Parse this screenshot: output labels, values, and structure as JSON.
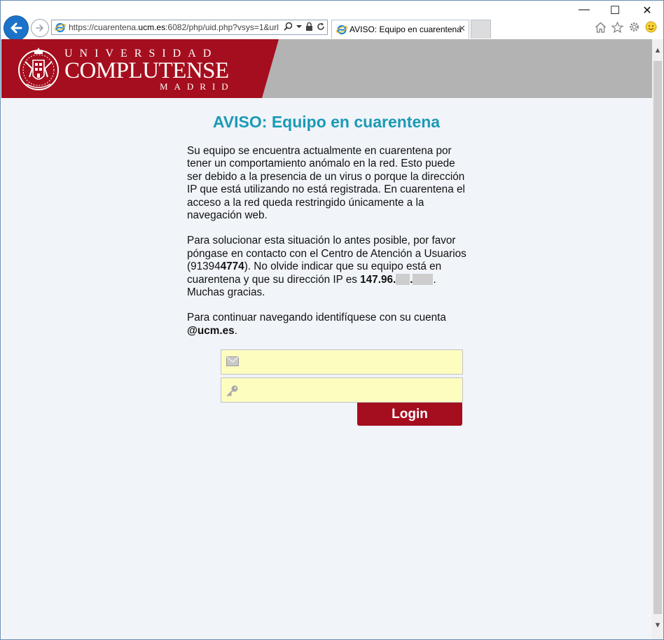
{
  "browser": {
    "url_prefix": "https://cuarentena.",
    "url_host": "ucm.es",
    "url_suffix": ":6082/php/uid.php?vsys=1&url",
    "tab_title": "AVISO: Equipo en cuarentena",
    "tab_close": "✕",
    "minimize": "—",
    "maximize": "☐",
    "close": "✕"
  },
  "logo": {
    "line1": "UNIVERSIDAD",
    "line2": "COMPLUTENSE",
    "line3": "MADRID"
  },
  "page": {
    "title": "AVISO: Equipo en cuarentena",
    "para1": "Su equipo se encuentra actualmente en cuarentena por tener un comportamiento anómalo en la red. Esto puede ser debido a la presencia de un virus o porque la dirección IP que está utilizando no está registrada. En cuarentena el acceso a la red queda restringido únicamente a la navegación web.",
    "para2_a": "Para solucionar esta situación lo antes posible, por favor póngase en contacto con el Centro de Atención a Usuarios (",
    "phone_a": "91394",
    "phone_b": "4774",
    "para2_b": "). No olvide indicar que su equipo está en cuarentena y que su dirección IP es ",
    "ip_prefix": "147.96.",
    "ip_dot": ".",
    "para2_c": ". Muchas gracias.",
    "para3_a": "Para continuar navegando identifíquese con su cuenta ",
    "para3_domain": "@ucm.es",
    "para3_end": "."
  },
  "form": {
    "login_label": "Login",
    "email_value": "",
    "password_value": ""
  },
  "colors": {
    "brand_red": "#a50e1e",
    "title_teal": "#1a9ab5",
    "field_yellow": "#fdfdc0"
  },
  "icons": [
    "back-arrow-icon",
    "forward-arrow-icon",
    "ie-icon",
    "search-icon",
    "dropdown-icon",
    "lock-icon",
    "refresh-icon",
    "home-icon",
    "star-icon",
    "gear-icon",
    "smiley-icon",
    "mail-icon",
    "key-icon"
  ]
}
